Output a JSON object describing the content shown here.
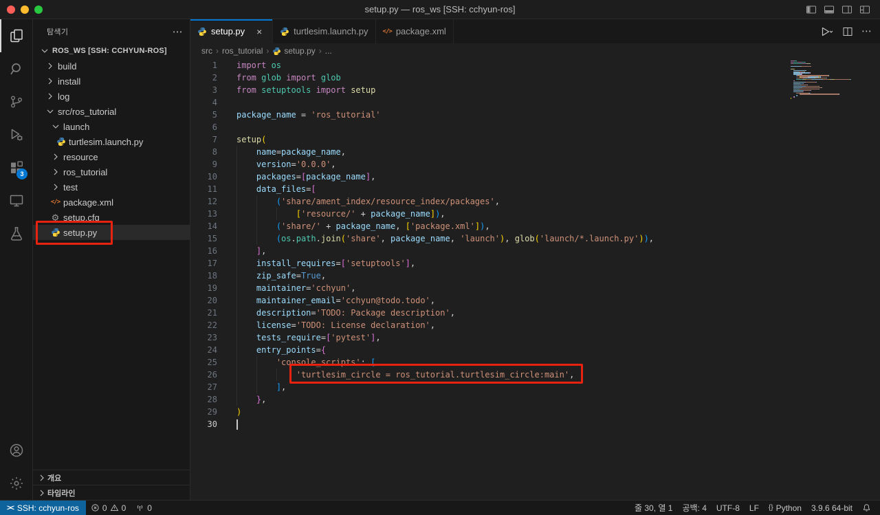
{
  "colors": {
    "ui": {
      "accent": "#0078d4",
      "remote_bg": "#0e639c",
      "annotation": "#e8220e",
      "traffic": [
        "#ff5f57",
        "#febc2e",
        "#28c840"
      ]
    },
    "tokens": {
      "k": "#C586C0",
      "t": "#4EC9B0",
      "f": "#DCDCAA",
      "v": "#9CDCFE",
      "s": "#CE9178",
      "c": "#569CD6",
      "p": "#D4D4D4",
      "b1": "#FFD700",
      "b2": "#DA70D6",
      "b3": "#179FFF",
      "w": "transparent"
    }
  },
  "title_bar": {
    "title": "setup.py — ros_ws [SSH: cchyun-ros]",
    "layout_icons": [
      "layout-sidebar",
      "layout-panel",
      "layout-sidebar-right",
      "layout-customize"
    ]
  },
  "activity_bar": {
    "items": [
      {
        "id": "explorer",
        "active": true
      },
      {
        "id": "search"
      },
      {
        "id": "source-control"
      },
      {
        "id": "run-debug"
      },
      {
        "id": "extensions",
        "badge": "3"
      },
      {
        "id": "remote-explorer"
      },
      {
        "id": "testing"
      }
    ],
    "bottom": [
      {
        "id": "account"
      },
      {
        "id": "settings"
      }
    ]
  },
  "sidebar": {
    "title": "탐색기",
    "tree": [
      {
        "label": "ROS_WS [SSH: CCHYUN-ROS]",
        "depth": 0,
        "kind": "folder",
        "expanded": true,
        "root": true
      },
      {
        "label": "build",
        "depth": 1,
        "kind": "folder",
        "expanded": false
      },
      {
        "label": "install",
        "depth": 1,
        "kind": "folder",
        "expanded": false
      },
      {
        "label": "log",
        "depth": 1,
        "kind": "folder",
        "expanded": false
      },
      {
        "label": "src/ros_tutorial",
        "depth": 1,
        "kind": "folder",
        "expanded": true
      },
      {
        "label": "launch",
        "depth": 2,
        "kind": "folder",
        "expanded": true
      },
      {
        "label": "turtlesim.launch.py",
        "depth": 3,
        "kind": "file",
        "icon": "python"
      },
      {
        "label": "resource",
        "depth": 2,
        "kind": "folder",
        "expanded": false
      },
      {
        "label": "ros_tutorial",
        "depth": 2,
        "kind": "folder",
        "expanded": false
      },
      {
        "label": "test",
        "depth": 2,
        "kind": "folder",
        "expanded": false
      },
      {
        "label": "package.xml",
        "depth": 2,
        "kind": "file",
        "icon": "xml"
      },
      {
        "label": "setup.cfg",
        "depth": 2,
        "kind": "file",
        "icon": "gear"
      },
      {
        "label": "setup.py",
        "depth": 2,
        "kind": "file",
        "icon": "python",
        "selected": true
      }
    ],
    "sections": [
      {
        "id": "outline",
        "label": "개요"
      },
      {
        "id": "timeline",
        "label": "타임라인"
      }
    ]
  },
  "tabs": [
    {
      "label": "setup.py",
      "icon": "python",
      "active": true
    },
    {
      "label": "turtlesim.launch.py",
      "icon": "python"
    },
    {
      "label": "package.xml",
      "icon": "xml"
    }
  ],
  "editor_actions": [
    {
      "id": "run"
    },
    {
      "id": "split-editor"
    },
    {
      "id": "more-actions"
    }
  ],
  "breadcrumbs": [
    {
      "label": "src"
    },
    {
      "label": "ros_tutorial"
    },
    {
      "label": "setup.py",
      "icon": "python"
    },
    {
      "label": "..."
    }
  ],
  "editor": {
    "cursor": {
      "line": 30,
      "column": 1
    },
    "lines": [
      [
        [
          "import",
          "k"
        ],
        [
          " os",
          "t"
        ]
      ],
      [
        [
          "from",
          "k"
        ],
        [
          " glob ",
          "t"
        ],
        [
          "import",
          "k"
        ],
        [
          " glob",
          "t"
        ]
      ],
      [
        [
          "from",
          "k"
        ],
        [
          " setuptools ",
          "t"
        ],
        [
          "import",
          "k"
        ],
        [
          " setup",
          "f"
        ]
      ],
      [],
      [
        [
          "package_name",
          "v"
        ],
        [
          " = ",
          "p"
        ],
        [
          "'ros_tutorial'",
          "s"
        ]
      ],
      [],
      [
        [
          "setup",
          "f"
        ],
        [
          "(",
          "b1"
        ]
      ],
      [
        [
          "    ",
          "w"
        ],
        [
          "name",
          "v"
        ],
        [
          "=",
          "p"
        ],
        [
          "package_name",
          "v"
        ],
        [
          ",",
          "p"
        ]
      ],
      [
        [
          "    ",
          "w"
        ],
        [
          "version",
          "v"
        ],
        [
          "=",
          "p"
        ],
        [
          "'0.0.0'",
          "s"
        ],
        [
          ",",
          "p"
        ]
      ],
      [
        [
          "    ",
          "w"
        ],
        [
          "packages",
          "v"
        ],
        [
          "=",
          "p"
        ],
        [
          "[",
          "b2"
        ],
        [
          "package_name",
          "v"
        ],
        [
          "]",
          "b2"
        ],
        [
          ",",
          "p"
        ]
      ],
      [
        [
          "    ",
          "w"
        ],
        [
          "data_files",
          "v"
        ],
        [
          "=",
          "p"
        ],
        [
          "[",
          "b2"
        ]
      ],
      [
        [
          "        ",
          "w"
        ],
        [
          "(",
          "b3"
        ],
        [
          "'share/ament_index/resource_index/packages'",
          "s"
        ],
        [
          ",",
          "p"
        ]
      ],
      [
        [
          "            ",
          "w"
        ],
        [
          "[",
          "b1"
        ],
        [
          "'resource/'",
          "s"
        ],
        [
          " + ",
          "p"
        ],
        [
          "package_name",
          "v"
        ],
        [
          "]",
          "b1"
        ],
        [
          ")",
          "b3"
        ],
        [
          ",",
          "p"
        ]
      ],
      [
        [
          "        ",
          "w"
        ],
        [
          "(",
          "b3"
        ],
        [
          "'share/'",
          "s"
        ],
        [
          " + ",
          "p"
        ],
        [
          "package_name",
          "v"
        ],
        [
          ", ",
          "p"
        ],
        [
          "[",
          "b1"
        ],
        [
          "'package.xml'",
          "s"
        ],
        [
          "]",
          "b1"
        ],
        [
          ")",
          "b3"
        ],
        [
          ",",
          "p"
        ]
      ],
      [
        [
          "        ",
          "w"
        ],
        [
          "(",
          "b3"
        ],
        [
          "os",
          "t"
        ],
        [
          ".",
          "p"
        ],
        [
          "path",
          "t"
        ],
        [
          ".",
          "p"
        ],
        [
          "join",
          "f"
        ],
        [
          "(",
          "b1"
        ],
        [
          "'share'",
          "s"
        ],
        [
          ", ",
          "p"
        ],
        [
          "package_name",
          "v"
        ],
        [
          ", ",
          "p"
        ],
        [
          "'launch'",
          "s"
        ],
        [
          ")",
          "b1"
        ],
        [
          ", ",
          "p"
        ],
        [
          "glob",
          "f"
        ],
        [
          "(",
          "b1"
        ],
        [
          "'launch/*.launch.py'",
          "s"
        ],
        [
          ")",
          "b1"
        ],
        [
          ")",
          "b3"
        ],
        [
          ",",
          "p"
        ]
      ],
      [
        [
          "    ",
          "w"
        ],
        [
          "]",
          "b2"
        ],
        [
          ",",
          "p"
        ]
      ],
      [
        [
          "    ",
          "w"
        ],
        [
          "install_requires",
          "v"
        ],
        [
          "=",
          "p"
        ],
        [
          "[",
          "b2"
        ],
        [
          "'setuptools'",
          "s"
        ],
        [
          "]",
          "b2"
        ],
        [
          ",",
          "p"
        ]
      ],
      [
        [
          "    ",
          "w"
        ],
        [
          "zip_safe",
          "v"
        ],
        [
          "=",
          "p"
        ],
        [
          "True",
          "c"
        ],
        [
          ",",
          "p"
        ]
      ],
      [
        [
          "    ",
          "w"
        ],
        [
          "maintainer",
          "v"
        ],
        [
          "=",
          "p"
        ],
        [
          "'cchyun'",
          "s"
        ],
        [
          ",",
          "p"
        ]
      ],
      [
        [
          "    ",
          "w"
        ],
        [
          "maintainer_email",
          "v"
        ],
        [
          "=",
          "p"
        ],
        [
          "'cchyun@todo.todo'",
          "s"
        ],
        [
          ",",
          "p"
        ]
      ],
      [
        [
          "    ",
          "w"
        ],
        [
          "description",
          "v"
        ],
        [
          "=",
          "p"
        ],
        [
          "'TODO: Package description'",
          "s"
        ],
        [
          ",",
          "p"
        ]
      ],
      [
        [
          "    ",
          "w"
        ],
        [
          "license",
          "v"
        ],
        [
          "=",
          "p"
        ],
        [
          "'TODO: License declaration'",
          "s"
        ],
        [
          ",",
          "p"
        ]
      ],
      [
        [
          "    ",
          "w"
        ],
        [
          "tests_require",
          "v"
        ],
        [
          "=",
          "p"
        ],
        [
          "[",
          "b2"
        ],
        [
          "'pytest'",
          "s"
        ],
        [
          "]",
          "b2"
        ],
        [
          ",",
          "p"
        ]
      ],
      [
        [
          "    ",
          "w"
        ],
        [
          "entry_points",
          "v"
        ],
        [
          "=",
          "p"
        ],
        [
          "{",
          "b2"
        ]
      ],
      [
        [
          "        ",
          "w"
        ],
        [
          "'console_scripts'",
          "s"
        ],
        [
          ": ",
          "p"
        ],
        [
          "[",
          "b3"
        ]
      ],
      [
        [
          "            ",
          "w"
        ],
        [
          "'turtlesim_circle = ros_tutorial.turtlesim_circle:main'",
          "s"
        ],
        [
          ",",
          "p"
        ]
      ],
      [
        [
          "        ",
          "w"
        ],
        [
          "]",
          "b3"
        ],
        [
          ",",
          "p"
        ]
      ],
      [
        [
          "    ",
          "w"
        ],
        [
          "}",
          "b2"
        ],
        [
          ",",
          "p"
        ]
      ],
      [
        [
          ")",
          "b1"
        ]
      ],
      []
    ]
  },
  "status_bar": {
    "remote": {
      "label": "SSH: cchyun-ros"
    },
    "problems": {
      "errors": "0",
      "warnings": "0"
    },
    "ports": {
      "count": "0"
    },
    "right": [
      {
        "id": "cursor-position",
        "label": "줄 30, 열 1"
      },
      {
        "id": "indentation",
        "label": "공백: 4"
      },
      {
        "id": "encoding",
        "label": "UTF-8"
      },
      {
        "id": "eol",
        "label": "LF"
      },
      {
        "id": "language-mode",
        "icon": "braces",
        "label": "Python"
      },
      {
        "id": "python-interpreter",
        "label": "3.9.6 64-bit"
      },
      {
        "id": "notifications",
        "icon": "bell",
        "label": ""
      }
    ]
  },
  "annotations": {
    "boxes": [
      {
        "id": "setup-py-file"
      },
      {
        "id": "entry-point-line-26"
      }
    ]
  }
}
